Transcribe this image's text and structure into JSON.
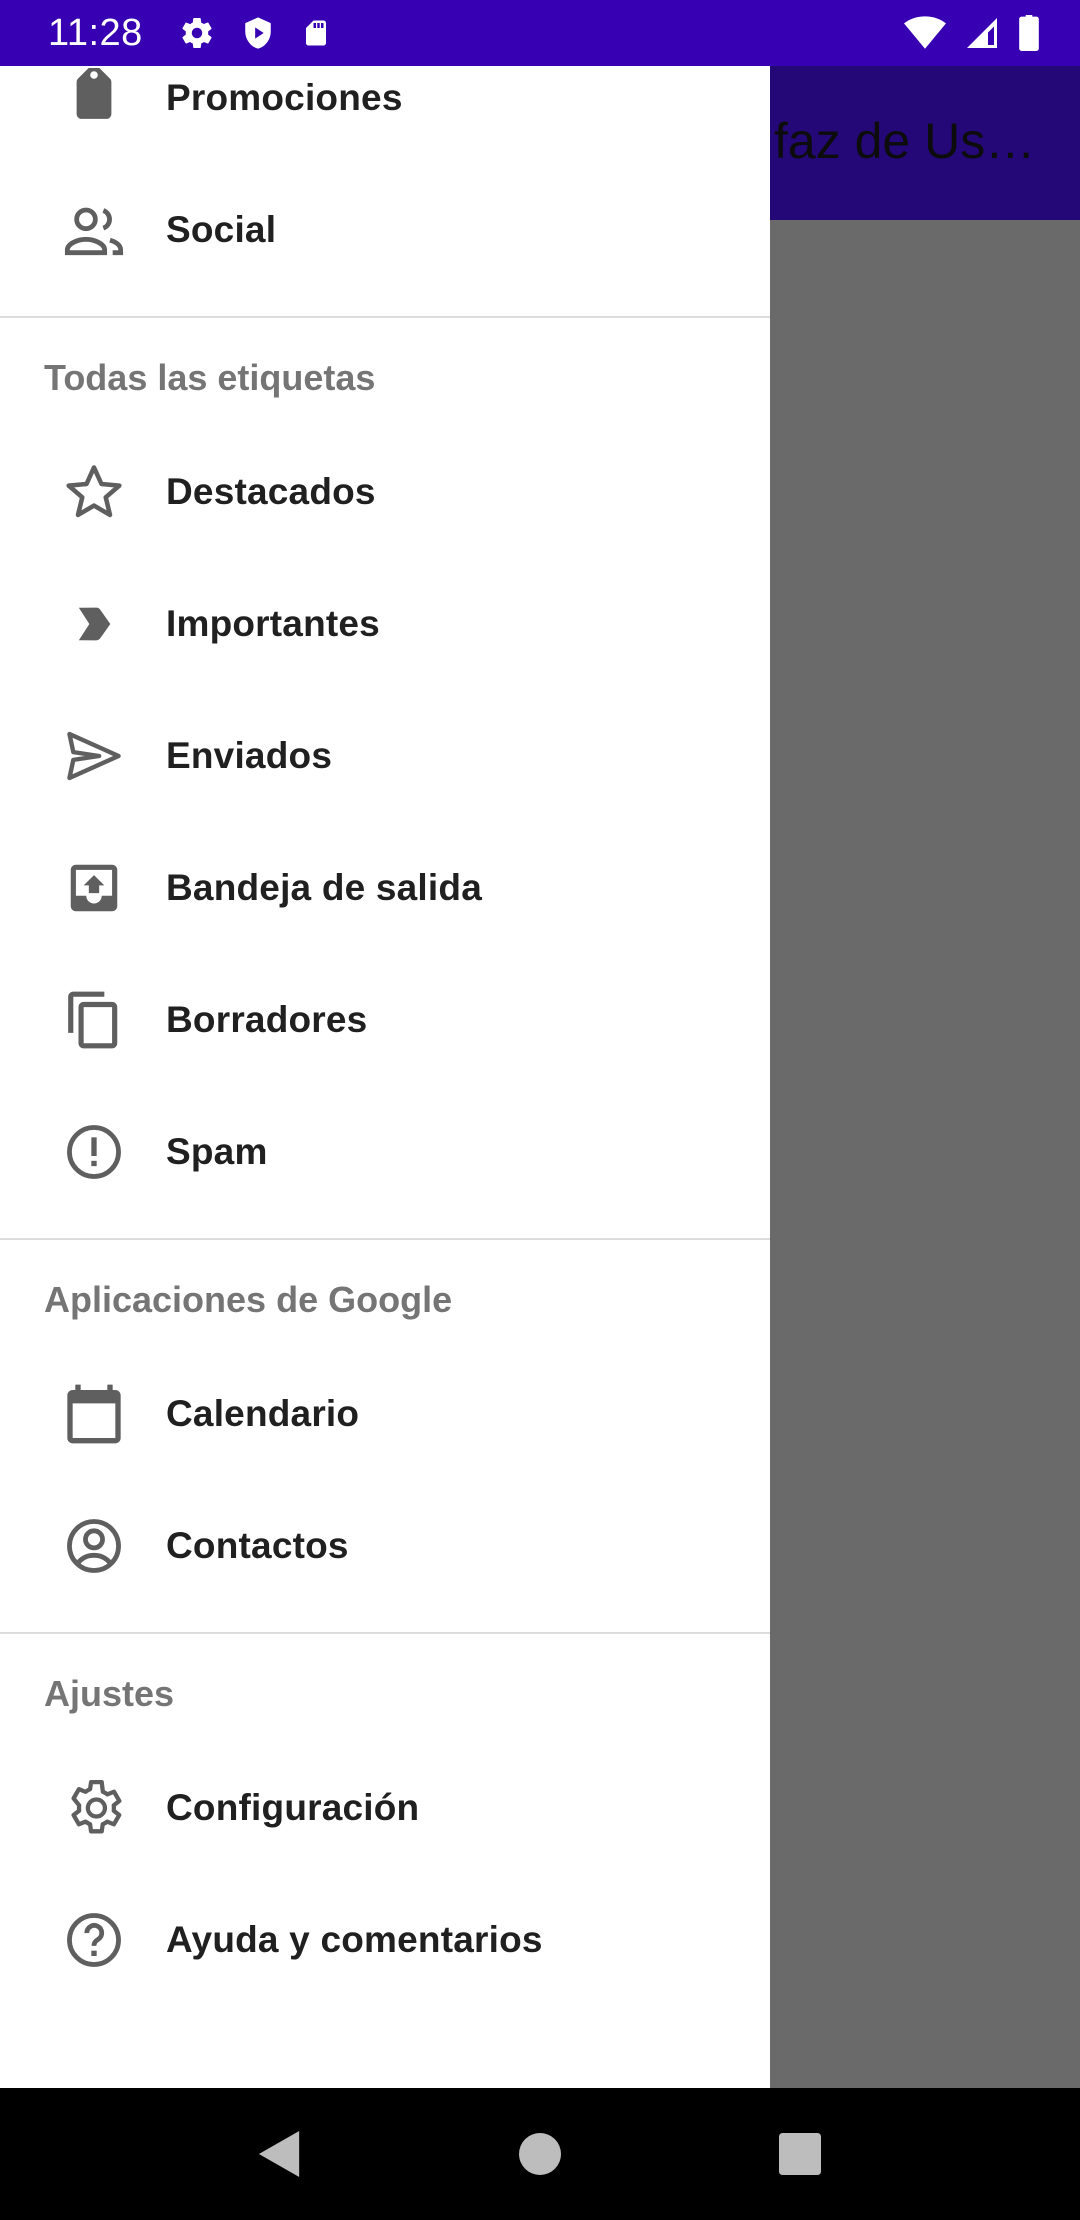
{
  "status_bar": {
    "time": "11:28",
    "icons": [
      "settings-icon",
      "play-protect-icon",
      "sd-card-icon",
      "wifi-icon",
      "signal-icon",
      "battery-icon"
    ],
    "background": "#3700b3"
  },
  "app_bar": {
    "title": "faz de Us…",
    "background": "#250878"
  },
  "drawer": {
    "top_items": [
      {
        "label": "Promociones",
        "icon": "tag-icon"
      },
      {
        "label": "Social",
        "icon": "people-icon"
      }
    ],
    "sections": [
      {
        "header": "Todas las etiquetas",
        "items": [
          {
            "label": "Destacados",
            "icon": "star-icon"
          },
          {
            "label": "Importantes",
            "icon": "label-important-icon"
          },
          {
            "label": "Enviados",
            "icon": "send-icon"
          },
          {
            "label": "Bandeja de salida",
            "icon": "outbox-icon"
          },
          {
            "label": "Borradores",
            "icon": "drafts-copy-icon"
          },
          {
            "label": "Spam",
            "icon": "alert-circle-icon"
          }
        ]
      },
      {
        "header": "Aplicaciones de Google",
        "items": [
          {
            "label": "Calendario",
            "icon": "calendar-icon"
          },
          {
            "label": "Contactos",
            "icon": "account-circle-icon"
          }
        ]
      },
      {
        "header": "Ajustes",
        "items": [
          {
            "label": "Configuración",
            "icon": "gear-icon"
          },
          {
            "label": "Ayuda y comentarios",
            "icon": "help-circle-icon"
          }
        ]
      }
    ]
  },
  "nav_bar": {
    "buttons": [
      "back-icon",
      "home-icon",
      "recents-icon"
    ]
  }
}
